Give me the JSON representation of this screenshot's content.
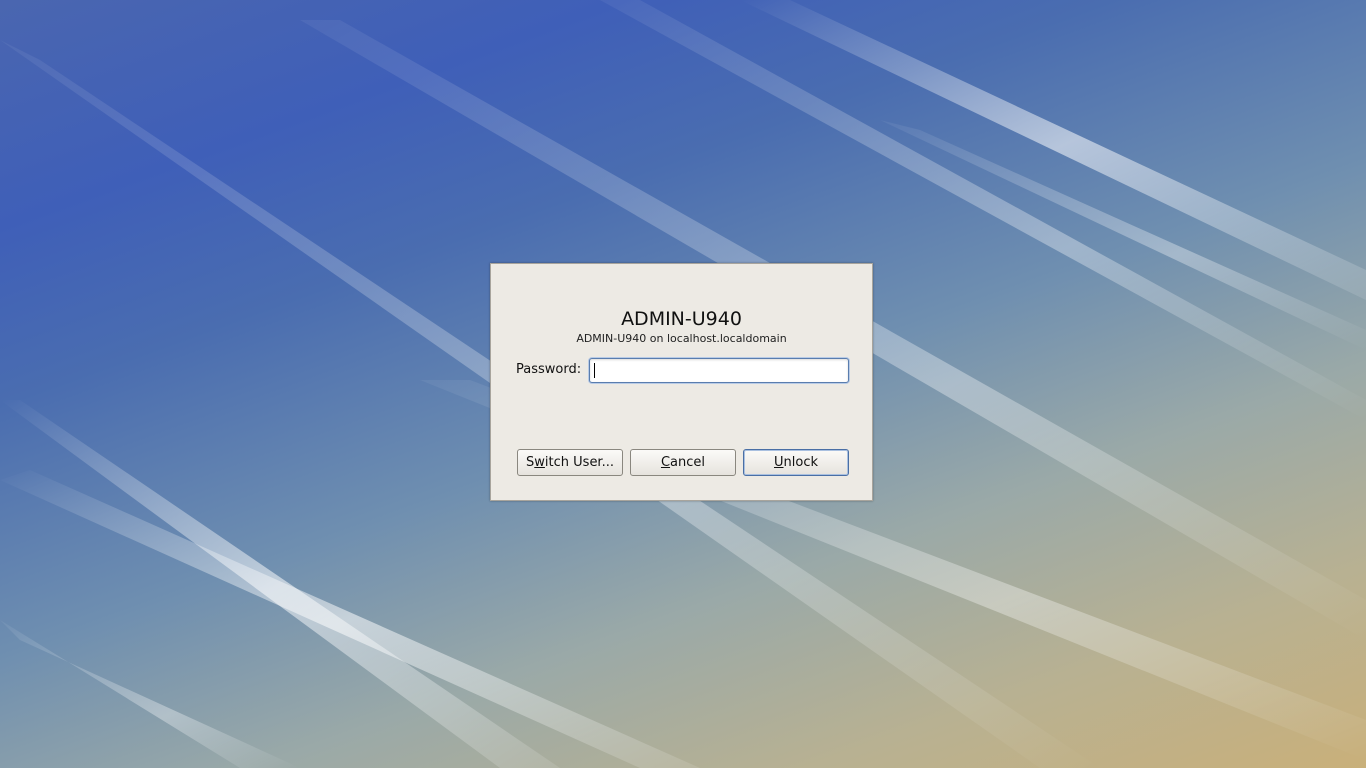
{
  "dialog": {
    "user_title": "ADMIN-U940",
    "user_subtitle": "ADMIN-U940 on localhost.localdomain",
    "password_label": "Password:",
    "password_value": ""
  },
  "buttons": {
    "switch_user": {
      "pre": "S",
      "mnemonic": "w",
      "post": "itch User..."
    },
    "cancel": {
      "pre": "",
      "mnemonic": "C",
      "post": "ancel"
    },
    "unlock": {
      "pre": "",
      "mnemonic": "U",
      "post": "nlock"
    }
  },
  "colors": {
    "dialog_bg": "#edeae4",
    "focus_border": "#4a6fa5"
  }
}
